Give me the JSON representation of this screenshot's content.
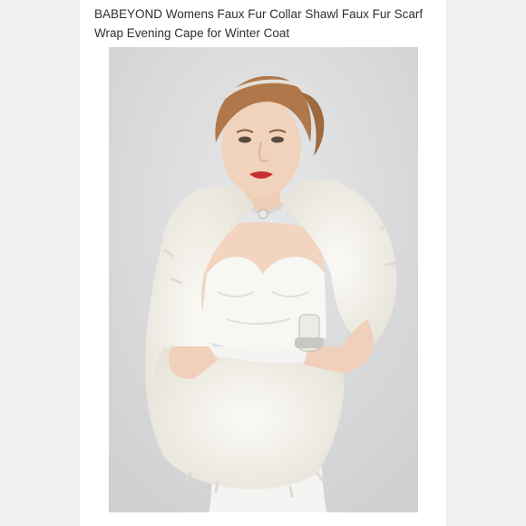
{
  "product": {
    "title": "BABEYOND Womens Faux Fur Collar Shawl Faux Fur Scarf Wrap Evening Cape for Winter Coat"
  },
  "image": {
    "background_color": "#d9dadc",
    "fur_color": "#f2f0ea",
    "dress_color": "#f7f7f5",
    "skin_color": "#f1d2bd",
    "hair_color": "#b0784a",
    "lip_color": "#c8302f"
  }
}
